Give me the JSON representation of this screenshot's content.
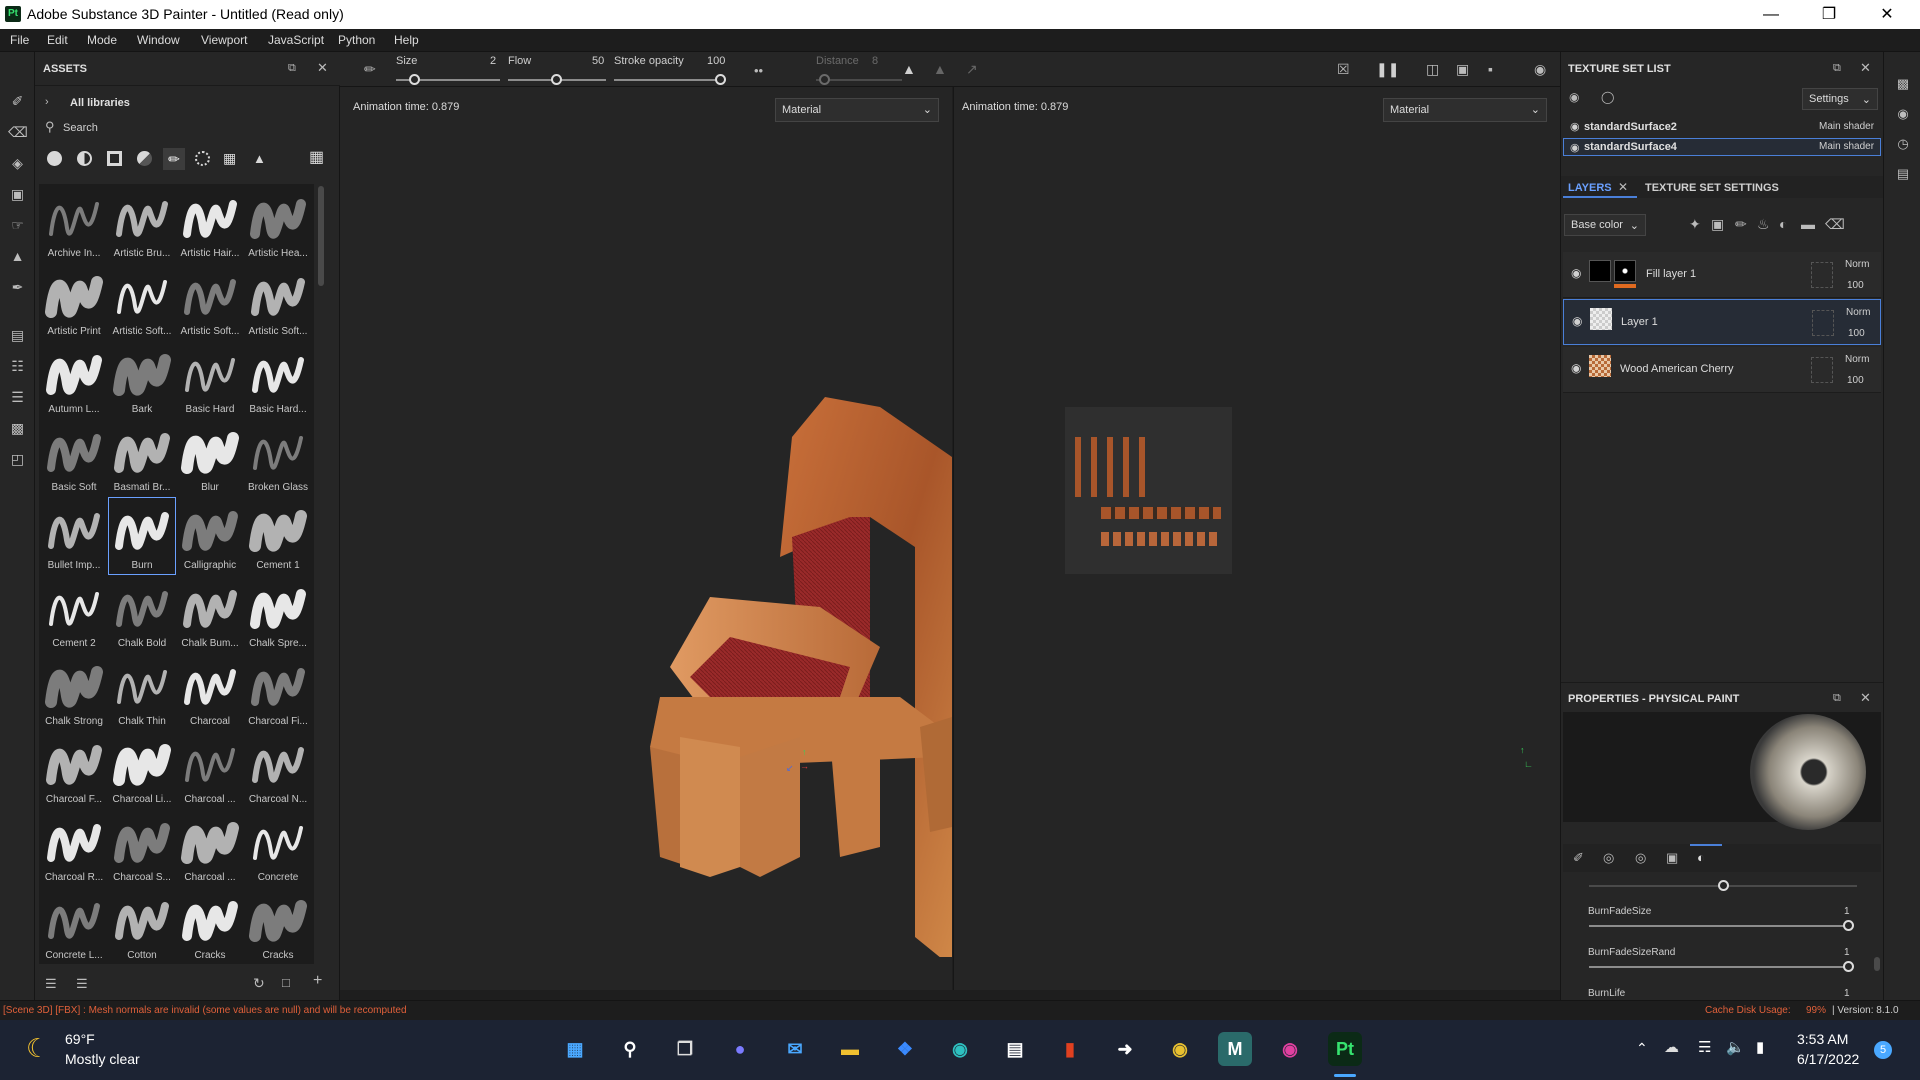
{
  "window": {
    "title": "Adobe Substance 3D Painter - Untitled (Read only)",
    "app_icon": "Pt"
  },
  "menu": [
    "File",
    "Edit",
    "Mode",
    "Window",
    "Viewport",
    "JavaScript",
    "Python",
    "Help"
  ],
  "assets": {
    "title": "ASSETS",
    "library": "All libraries",
    "search_placeholder": "Search",
    "items": [
      "Archive In...",
      "Artistic Bru...",
      "Artistic Hair...",
      "Artistic Hea...",
      "Artistic Print",
      "Artistic Soft...",
      "Artistic Soft...",
      "Artistic Soft...",
      "Autumn L...",
      "Bark",
      "Basic Hard",
      "Basic Hard...",
      "Basic Soft",
      "Basmati Br...",
      "Blur",
      "Broken Glass",
      "Bullet Imp...",
      "Burn",
      "Calligraphic",
      "Cement 1",
      "Cement 2",
      "Chalk Bold",
      "Chalk Bum...",
      "Chalk Spre...",
      "Chalk Strong",
      "Chalk Thin",
      "Charcoal",
      "Charcoal Fi...",
      "Charcoal F...",
      "Charcoal Li...",
      "Charcoal ...",
      "Charcoal N...",
      "Charcoal R...",
      "Charcoal S...",
      "Charcoal ...",
      "Concrete",
      "Concrete L...",
      "Cotton",
      "Cracks",
      "Cracks"
    ],
    "selected_item": "Burn"
  },
  "toolbar": {
    "size_label": "Size",
    "size_value": "2",
    "flow_label": "Flow",
    "flow_value": "50",
    "stroke_label": "Stroke opacity",
    "stroke_value": "100",
    "distance_label": "Distance",
    "distance_value": "8"
  },
  "viewport3d": {
    "anim_time": "Animation time: 0.879",
    "mode": "Material"
  },
  "viewport2d": {
    "anim_time": "Animation time: 0.879",
    "mode": "Material"
  },
  "texture_set_list": {
    "title": "TEXTURE SET LIST",
    "settings": "Settings",
    "sets": [
      {
        "name": "standardSurface2",
        "shader": "Main shader"
      },
      {
        "name": "standardSurface4",
        "shader": "Main shader"
      }
    ]
  },
  "layers": {
    "tab_layers": "LAYERS",
    "tab_settings": "TEXTURE SET SETTINGS",
    "channel": "Base color",
    "items": [
      {
        "name": "Fill layer 1",
        "blend": "Norm",
        "opacity": "100"
      },
      {
        "name": "Layer 1",
        "blend": "Norm",
        "opacity": "100"
      },
      {
        "name": "Wood American Cherry",
        "blend": "Norm",
        "opacity": "100"
      }
    ]
  },
  "properties": {
    "title": "PROPERTIES - PHYSICAL PAINT",
    "params": [
      {
        "name": "BurnFadeSize",
        "value": "1"
      },
      {
        "name": "BurnFadeSizeRand",
        "value": "1"
      },
      {
        "name": "BurnLife",
        "value": "1"
      }
    ]
  },
  "status": {
    "message": "[Scene 3D] [FBX] : Mesh normals are invalid (some values are null) and will be recomputed",
    "cache_label": "Cache Disk Usage:",
    "cache_value": "99%",
    "version": "| Version: 8.1.0"
  },
  "taskbar": {
    "temp": "69°F",
    "weather": "Mostly clear",
    "time": "3:53 AM",
    "date": "6/17/2022",
    "notif_count": "5"
  },
  "colors": {
    "accent": "#4a7fd8",
    "warning": "#e0603a",
    "wood": "#b8642c"
  }
}
